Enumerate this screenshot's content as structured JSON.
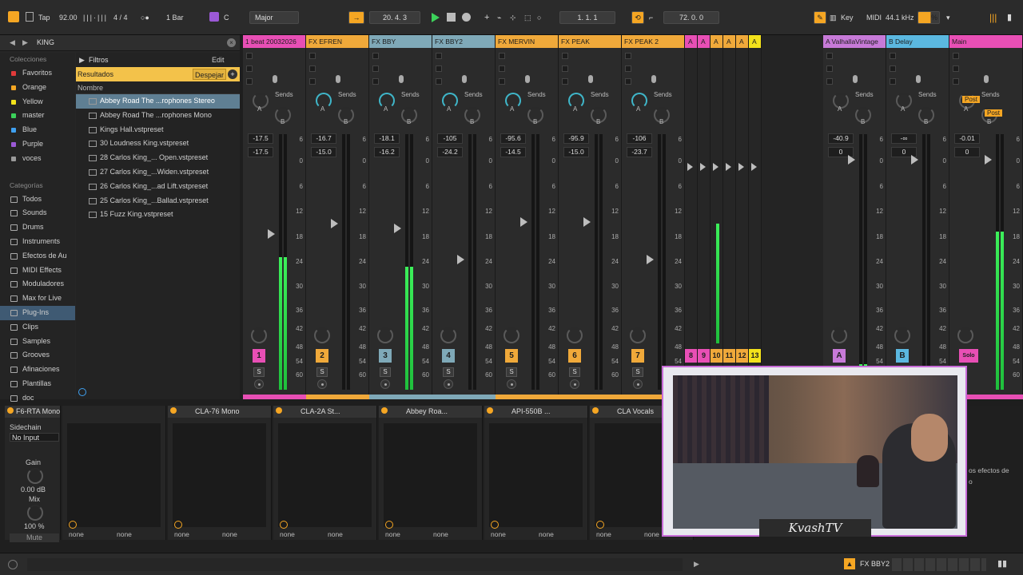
{
  "transport": {
    "tap": "Tap",
    "tempo": "92.00",
    "signature": "4 / 4",
    "quantize": "1 Bar",
    "key": "C",
    "scale": "Major",
    "position": "20.   4.   3",
    "loop_start": "1.   1.   1",
    "loop_length": "72.   0.   0",
    "key_label": "Key",
    "midi_label": "MIDI",
    "sample_rate": "44.1 kHz",
    "cpu": "%"
  },
  "browser": {
    "search": "KING",
    "filters": "Filtros",
    "edit": "Edit",
    "results": "Resultados",
    "clear": "Despejar",
    "name_col": "Nombre",
    "collections_title": "Colecciones",
    "collections": [
      {
        "label": "Favoritos",
        "color": "#e03a3a"
      },
      {
        "label": "Orange",
        "color": "#f5a623"
      },
      {
        "label": "Yellow",
        "color": "#f3e21b"
      },
      {
        "label": "master",
        "color": "#3bd15a"
      },
      {
        "label": "Blue",
        "color": "#3fa0f0"
      },
      {
        "label": "Purple",
        "color": "#9b59d6"
      },
      {
        "label": "voces",
        "color": "#9a9a9a"
      }
    ],
    "categories_title": "Categorías",
    "categories": [
      "Todos",
      "Sounds",
      "Drums",
      "Instruments",
      "Efectos de Au",
      "MIDI Effects",
      "Moduladores",
      "Max for Live",
      "Plug-Ins",
      "Clips",
      "Samples",
      "Grooves",
      "Afinaciones",
      "Plantillas",
      "doc"
    ],
    "files": [
      "Abbey Road The ...rophones Stereo",
      "Abbey Road The ...rophones Mono",
      "Kings Hall.vstpreset",
      "30 Loudness King.vstpreset",
      "28 Carlos King_... Open.vstpreset",
      "27 Carlos King_...Widen.vstpreset",
      "26 Carlos King_...ad Lift.vstpreset",
      "25 Carlos King_...Ballad.vstpreset",
      "15 Fuzz King.vstpreset"
    ]
  },
  "mixer": {
    "sends": "Sends",
    "a": "A",
    "b": "B",
    "s": "S",
    "post": "Post",
    "ticks": [
      "6",
      "0",
      "6",
      "12",
      "18",
      "24",
      "30",
      "36",
      "42",
      "48",
      "54",
      "60"
    ],
    "tracks": [
      {
        "name": "1 beat 20032026",
        "color": "#e84fb5",
        "v1": "-17.5",
        "v2": "-17.5",
        "num": "1",
        "level": 0.52,
        "active": false
      },
      {
        "name": "FX EFREN",
        "color": "#f0a93a",
        "v1": "-16.7",
        "v2": "-15.0",
        "num": "2",
        "level": 0,
        "active": true
      },
      {
        "name": "FX BBY",
        "color": "#7fa9b8",
        "v1": "-18.1",
        "v2": "-16.2",
        "num": "3",
        "level": 0.48,
        "active": true
      },
      {
        "name": "FX BBY2",
        "color": "#7fa9b8",
        "v1": "-105",
        "v2": "-24.2",
        "num": "4",
        "level": 0,
        "active": true
      },
      {
        "name": "FX MERVIN",
        "color": "#f0a93a",
        "v1": "-95.6",
        "v2": "-14.5",
        "num": "5",
        "level": 0,
        "active": true
      },
      {
        "name": "FX PEAK",
        "color": "#f0a93a",
        "v1": "-95.9",
        "v2": "-15.0",
        "num": "6",
        "level": 0,
        "active": true
      },
      {
        "name": "FX PEAK 2",
        "color": "#f0a93a",
        "v1": "-106",
        "v2": "-23.7",
        "num": "7",
        "level": 0,
        "active": true
      }
    ],
    "mini_tracks": [
      {
        "name": "A",
        "color": "#e84fb5",
        "num": "8"
      },
      {
        "name": "A",
        "color": "#e84fb5",
        "num": "9"
      },
      {
        "name": "A",
        "color": "#f0a93a",
        "num": "10"
      },
      {
        "name": "A",
        "color": "#f0a93a",
        "num": "11"
      },
      {
        "name": "A",
        "color": "#f0a93a",
        "num": "12"
      },
      {
        "name": "A",
        "color": "#f3e21b",
        "num": "13"
      }
    ],
    "returns": [
      {
        "name": "A ValhallaVintage",
        "color": "#c77ad8",
        "v1": "-40.9",
        "v2": "0",
        "letter": "A"
      },
      {
        "name": "B Delay",
        "color": "#5bb8e0",
        "v1": "-∞",
        "v2": "0",
        "letter": "B"
      },
      {
        "name": "Main",
        "color": "#e84fb5",
        "v1": "-0.01",
        "v2": "0",
        "letter": "Solo"
      }
    ]
  },
  "devices": {
    "rta": {
      "name": "F6-RTA Mono",
      "sidechain": "Sidechain",
      "input": "No Input",
      "gain_label": "Gain",
      "gain": "0.00 dB",
      "mix_label": "Mix",
      "mix": "100 %",
      "mute": "Mute"
    },
    "plugins": [
      "CLA-76 Mono",
      "CLA-2A St...",
      "Abbey Roa...",
      "API-550B ...",
      "CLA Vocals"
    ],
    "none": "none"
  },
  "webcam": {
    "caption": "KvashTV"
  },
  "overlay_text": [
    "os efectos de",
    "o"
  ],
  "status": {
    "track": "FX BBY2"
  }
}
